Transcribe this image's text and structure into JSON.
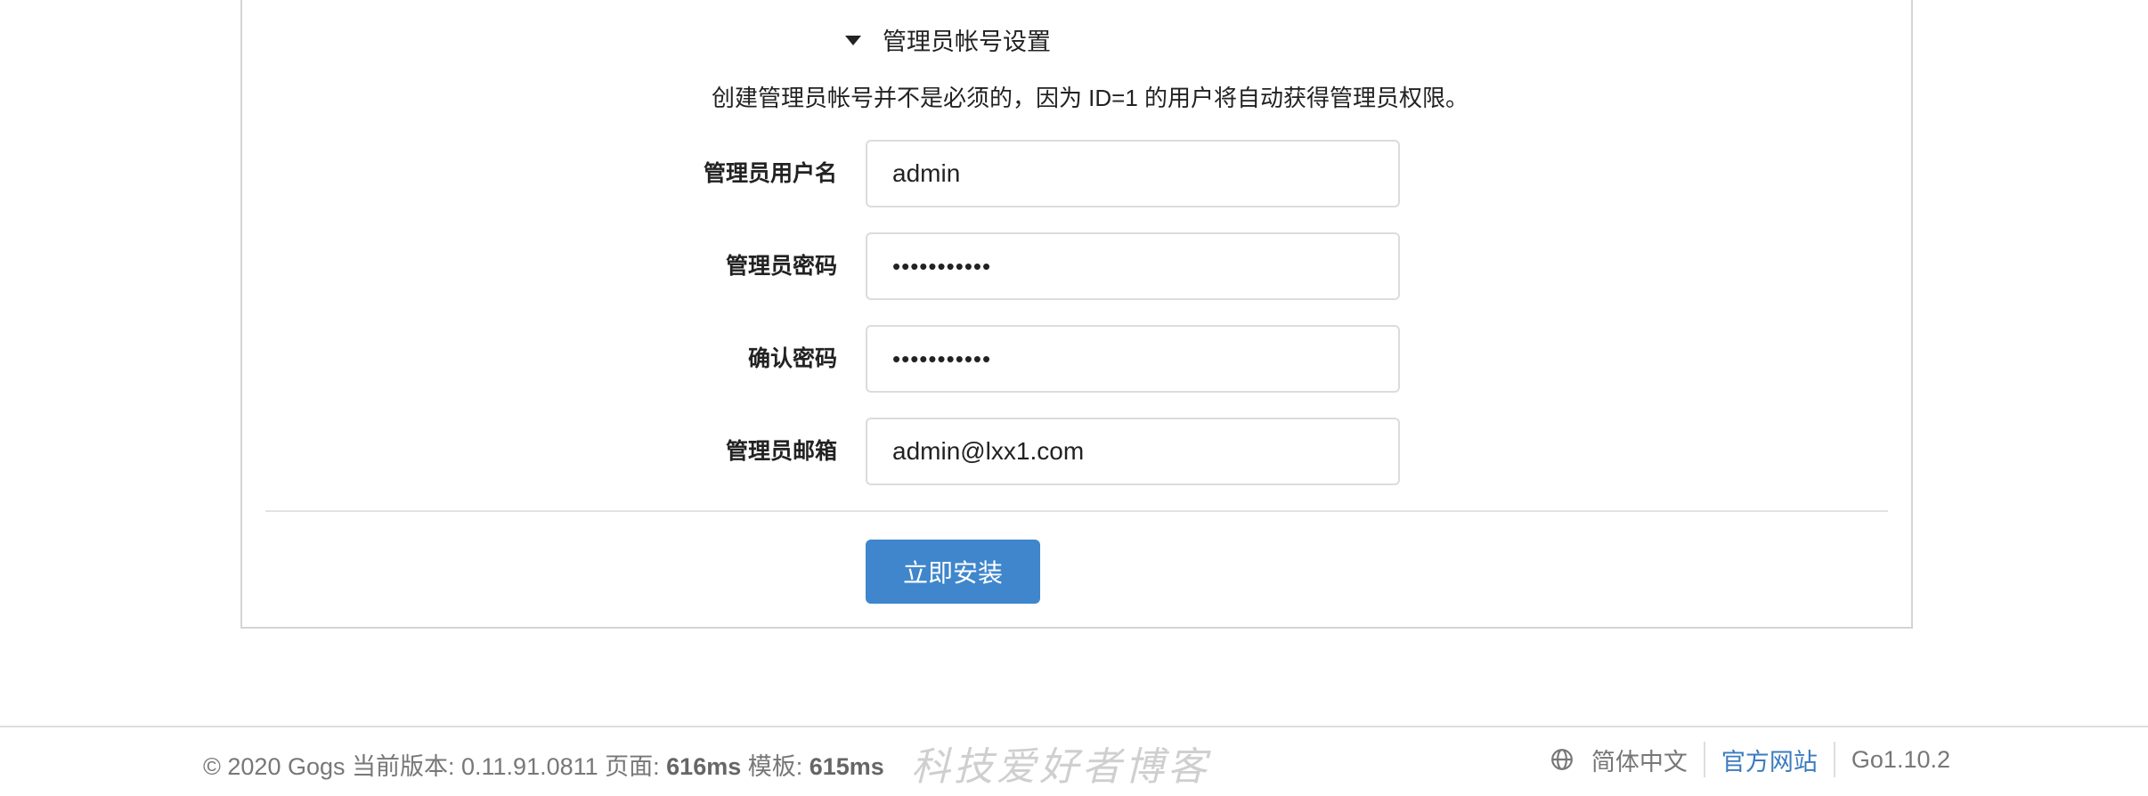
{
  "section": {
    "title": "管理员帐号设置",
    "help_text": "创建管理员帐号并不是必须的，因为 ID=1 的用户将自动获得管理员权限。"
  },
  "fields": [
    {
      "label": "管理员用户名",
      "value": "admin",
      "type": "text"
    },
    {
      "label": "管理员密码",
      "value": "•••••••••••",
      "type": "password"
    },
    {
      "label": "确认密码",
      "value": "•••••••••••",
      "type": "password"
    },
    {
      "label": "管理员邮箱",
      "value": "admin@lxx1.com",
      "type": "text"
    }
  ],
  "install_button": "立即安装",
  "footer": {
    "copyright": "© 2020 Gogs 当前版本: 0.11.91.0811 页面: ",
    "page_time": "616ms",
    "template_label": " 模板: ",
    "template_time": "615ms",
    "watermark": "科技爱好者博客",
    "language": "简体中文",
    "official_site": "官方网站",
    "go_version": "Go1.10.2",
    "icons": {
      "language": "globe-icon",
      "section_toggle": "caret-down-icon"
    }
  }
}
